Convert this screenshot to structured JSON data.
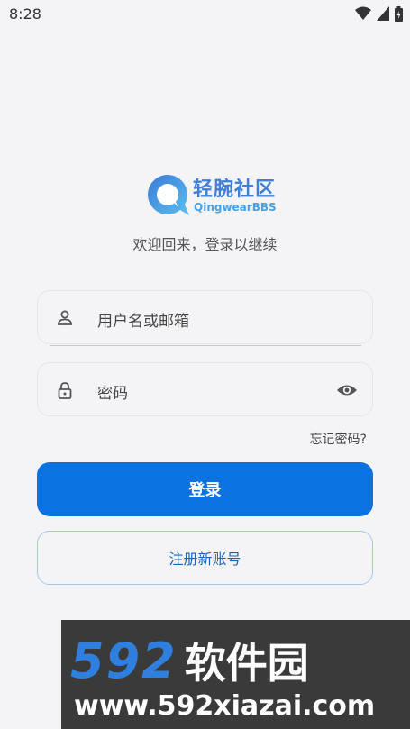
{
  "status_bar": {
    "time": "8:28"
  },
  "logo": {
    "title": "轻腕社区",
    "subtitle": "QingwearBBS"
  },
  "welcome": "欢迎回来，登录以继续",
  "form": {
    "username_placeholder": "用户名或邮箱",
    "password_placeholder": "密码",
    "forgot_password": "忘记密码?"
  },
  "buttons": {
    "login": "登录",
    "register": "注册新账号"
  },
  "watermark": {
    "brand_number": "592",
    "brand_text": "软件园",
    "url": "www.592xiazai.com"
  },
  "colors": {
    "primary": "#0a73e0",
    "background": "#f4f4f6",
    "logo_blue": "#3f7fd8"
  }
}
